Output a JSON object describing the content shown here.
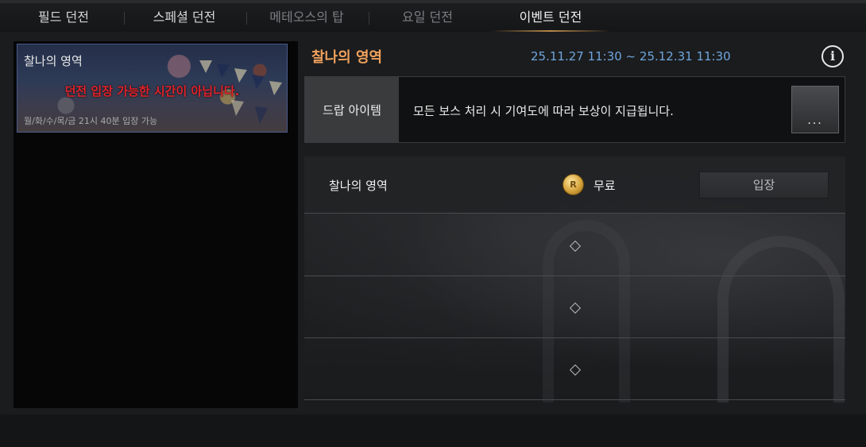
{
  "tabs": [
    {
      "label": "필드 던전",
      "state": "normal"
    },
    {
      "label": "스페셜 던전",
      "state": "normal"
    },
    {
      "label": "메테오스의 탑",
      "state": "disabled"
    },
    {
      "label": "요일 던전",
      "state": "disabled"
    },
    {
      "label": "이벤트 던전",
      "state": "active"
    }
  ],
  "dungeon_list": [
    {
      "title": "찰나의 영역",
      "warning": "던전 입장 가능한 시간이 아닙니다.",
      "schedule_note": "월/화/수/목/금 21시 40분 입장 가능"
    }
  ],
  "detail": {
    "name": "찰나의 영역",
    "period": "25.11.27 11:30 ~ 25.12.31 11:30",
    "info_icon": "info-icon",
    "drop": {
      "label": "드랍 아이템",
      "text": "모든 보스 처리 시 기여도에 따라 보상이 지급됩니다.",
      "more_label": "..."
    },
    "entry": {
      "name": "찰나의 영역",
      "currency_icon": "r-coin-icon",
      "currency_mark": "R",
      "cost": "무료",
      "enter_label": "입장"
    },
    "empty_slots": 3
  },
  "colors": {
    "accent_orange": "#f0a15c",
    "period_blue": "#6fa6dc",
    "warning_red": "#e0222a"
  }
}
